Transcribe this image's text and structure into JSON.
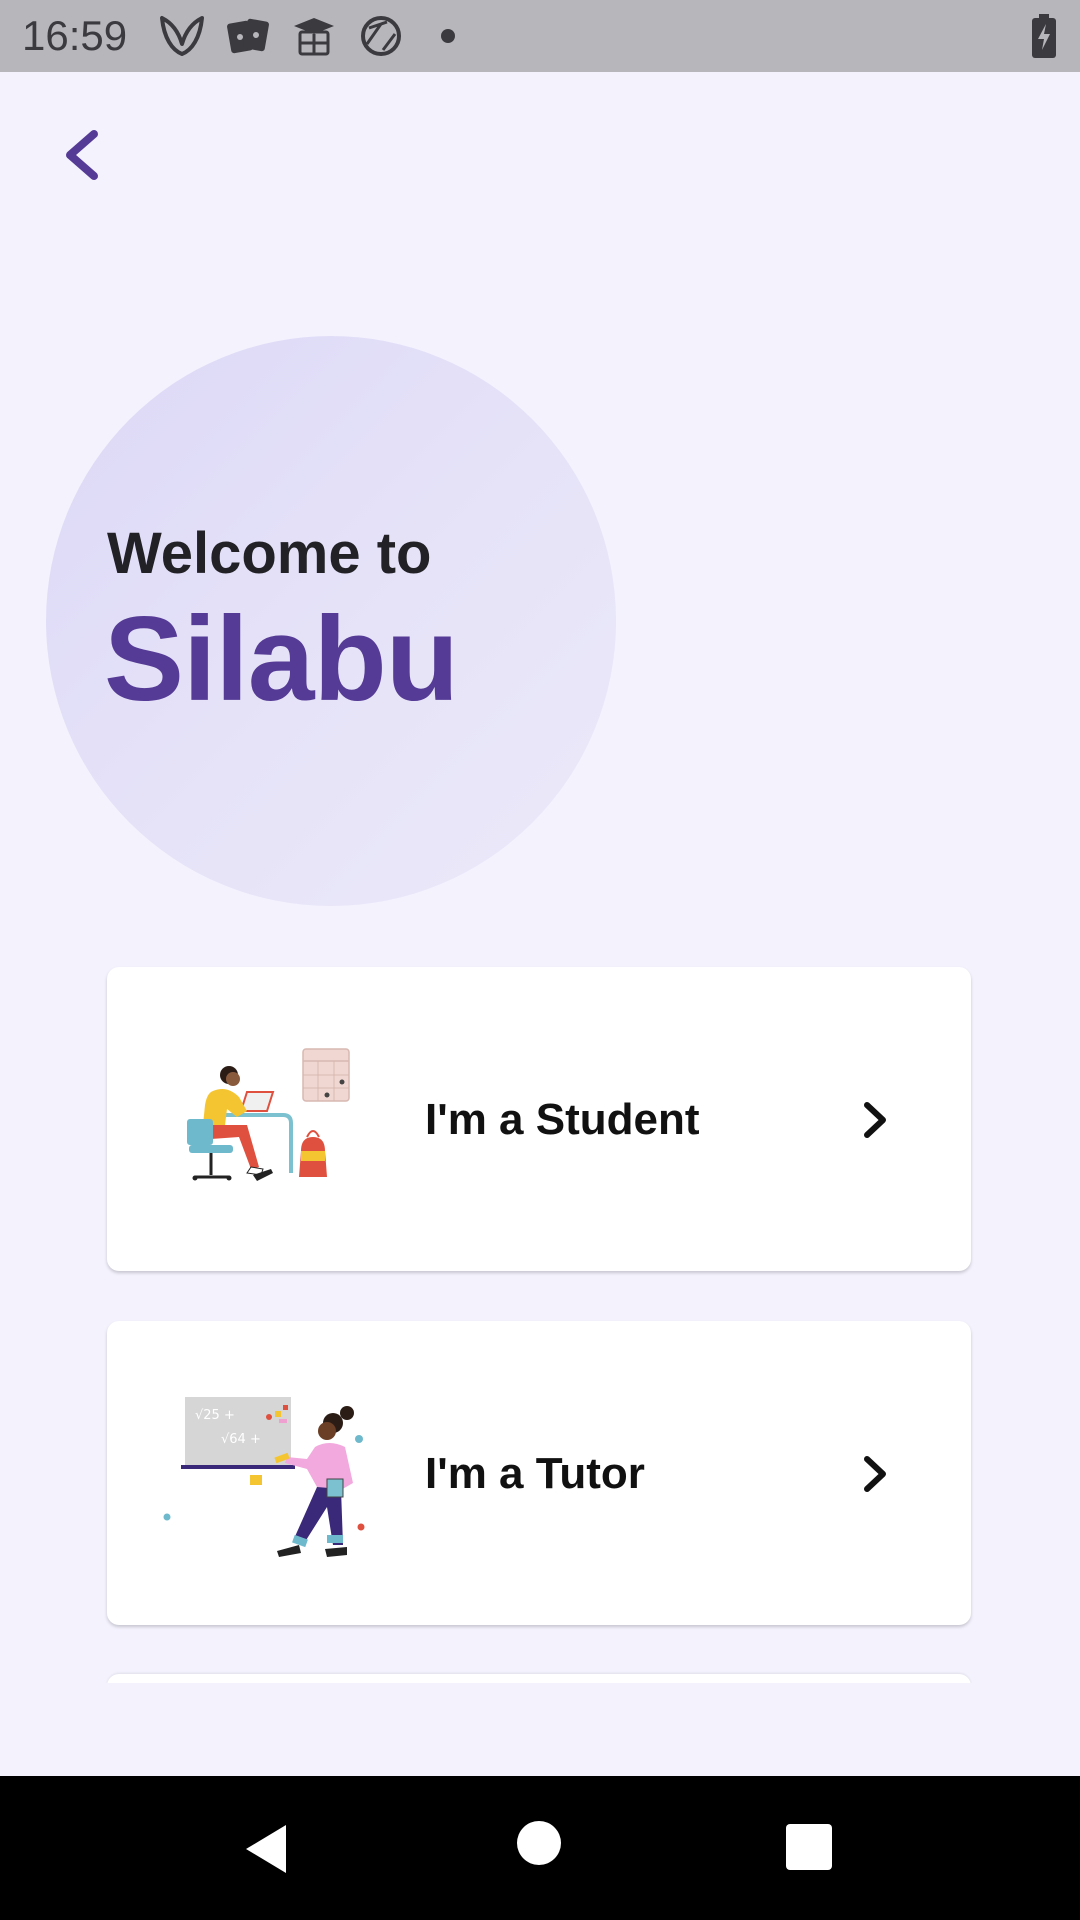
{
  "status_bar": {
    "time": "16:59",
    "icons": [
      "leaf-app-icon",
      "cards-app-icon",
      "graduation-app-icon",
      "aperture-app-icon",
      "notification-dot",
      "battery-charging-icon"
    ]
  },
  "header": {
    "back_icon": "chevron-left-icon"
  },
  "welcome": {
    "line": "Welcome to",
    "brand": "Silabu"
  },
  "roles": [
    {
      "label": "I'm a Student",
      "illustration": "student-at-desk-illustration",
      "chevron": "chevron-right-icon"
    },
    {
      "label": "I'm a Tutor",
      "illustration": "tutor-at-whiteboard-illustration",
      "chevron": "chevron-right-icon"
    }
  ],
  "colors": {
    "background": "#f3f2fd",
    "brand": "#553b95",
    "circle": "#e2dff8",
    "card": "#ffffff",
    "status_bar": "#b7b6bb",
    "nav_bar": "#000000"
  },
  "nav_bar": {
    "buttons": [
      "back-triangle",
      "home-circle",
      "recents-square"
    ]
  }
}
